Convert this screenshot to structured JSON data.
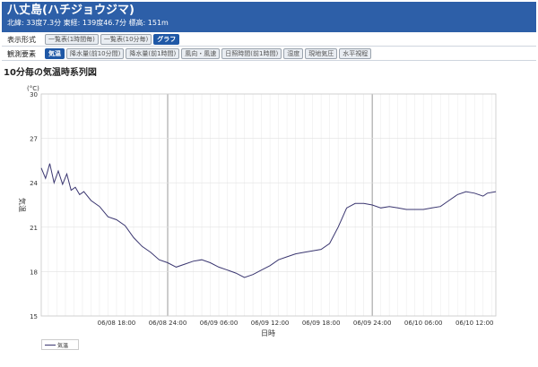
{
  "header": {
    "title": "八丈島(ハチジョウジマ)",
    "sub": "北緯: 33度7.3分 東経: 139度46.7分 標高: 151m"
  },
  "display_row": {
    "label": "表示形式",
    "buttons": [
      "一覧表(1時間毎)",
      "一覧表(10分毎)",
      "グラフ"
    ],
    "active": 2
  },
  "element_row": {
    "label": "観測要素",
    "buttons": [
      "気温",
      "降水量(前10分間)",
      "降水量(前1時間)",
      "風向・風速",
      "日照時間(前1時間)",
      "湿度",
      "現地気圧",
      "水平視程"
    ],
    "active": 0
  },
  "chart_title": "10分毎の気温時系列図",
  "chart_data": {
    "type": "line",
    "ylabel": "気温",
    "yunit": "(°C)",
    "xlabel": "日時",
    "ylim": [
      15,
      30
    ],
    "yticks": [
      15,
      18,
      21,
      24,
      27,
      30
    ],
    "xlim": [
      "06/08 09:10",
      "06/10 14:30"
    ],
    "xticks": [
      "06/08 18:00",
      "06/08 24:00",
      "06/09 06:00",
      "06/09 12:00",
      "06/09 18:00",
      "06/09 24:00",
      "06/10 06:00",
      "06/10 12:00"
    ],
    "legend": "気温",
    "series": [
      {
        "name": "気温",
        "color": "#3a3670",
        "points": [
          [
            "06/08 09:10",
            25.0
          ],
          [
            "06/08 09:40",
            24.3
          ],
          [
            "06/08 10:10",
            25.3
          ],
          [
            "06/08 10:40",
            24.0
          ],
          [
            "06/08 11:10",
            24.8
          ],
          [
            "06/08 11:40",
            23.9
          ],
          [
            "06/08 12:10",
            24.6
          ],
          [
            "06/08 12:40",
            23.5
          ],
          [
            "06/08 13:10",
            23.7
          ],
          [
            "06/08 13:40",
            23.2
          ],
          [
            "06/08 14:10",
            23.4
          ],
          [
            "06/08 15:00",
            22.8
          ],
          [
            "06/08 16:00",
            22.4
          ],
          [
            "06/08 17:00",
            21.7
          ],
          [
            "06/08 18:00",
            21.5
          ],
          [
            "06/08 19:00",
            21.1
          ],
          [
            "06/08 20:00",
            20.3
          ],
          [
            "06/08 21:00",
            19.7
          ],
          [
            "06/08 22:00",
            19.3
          ],
          [
            "06/08 23:00",
            18.8
          ],
          [
            "06/08 24:00",
            18.6
          ],
          [
            "06/09 01:00",
            18.3
          ],
          [
            "06/09 02:00",
            18.5
          ],
          [
            "06/09 03:00",
            18.7
          ],
          [
            "06/09 04:00",
            18.8
          ],
          [
            "06/09 05:00",
            18.6
          ],
          [
            "06/09 06:00",
            18.3
          ],
          [
            "06/09 07:00",
            18.1
          ],
          [
            "06/09 08:00",
            17.9
          ],
          [
            "06/09 09:00",
            17.6
          ],
          [
            "06/09 10:00",
            17.8
          ],
          [
            "06/09 11:00",
            18.1
          ],
          [
            "06/09 12:00",
            18.4
          ],
          [
            "06/09 13:00",
            18.8
          ],
          [
            "06/09 14:00",
            19.0
          ],
          [
            "06/09 15:00",
            19.2
          ],
          [
            "06/09 16:00",
            19.3
          ],
          [
            "06/09 17:00",
            19.4
          ],
          [
            "06/09 18:00",
            19.5
          ],
          [
            "06/09 19:00",
            19.9
          ],
          [
            "06/09 20:00",
            21.0
          ],
          [
            "06/09 21:00",
            22.3
          ],
          [
            "06/09 22:00",
            22.6
          ],
          [
            "06/09 23:00",
            22.6
          ],
          [
            "06/09 24:00",
            22.5
          ],
          [
            "06/10 01:00",
            22.3
          ],
          [
            "06/10 02:00",
            22.4
          ],
          [
            "06/10 03:00",
            22.3
          ],
          [
            "06/10 04:00",
            22.2
          ],
          [
            "06/10 05:00",
            22.2
          ],
          [
            "06/10 06:00",
            22.2
          ],
          [
            "06/10 07:00",
            22.3
          ],
          [
            "06/10 08:00",
            22.4
          ],
          [
            "06/10 09:00",
            22.8
          ],
          [
            "06/10 10:00",
            23.2
          ],
          [
            "06/10 11:00",
            23.4
          ],
          [
            "06/10 12:00",
            23.3
          ],
          [
            "06/10 13:00",
            23.1
          ],
          [
            "06/10 13:30",
            23.3
          ],
          [
            "06/10 14:30",
            23.4
          ]
        ]
      }
    ],
    "grid": true
  }
}
